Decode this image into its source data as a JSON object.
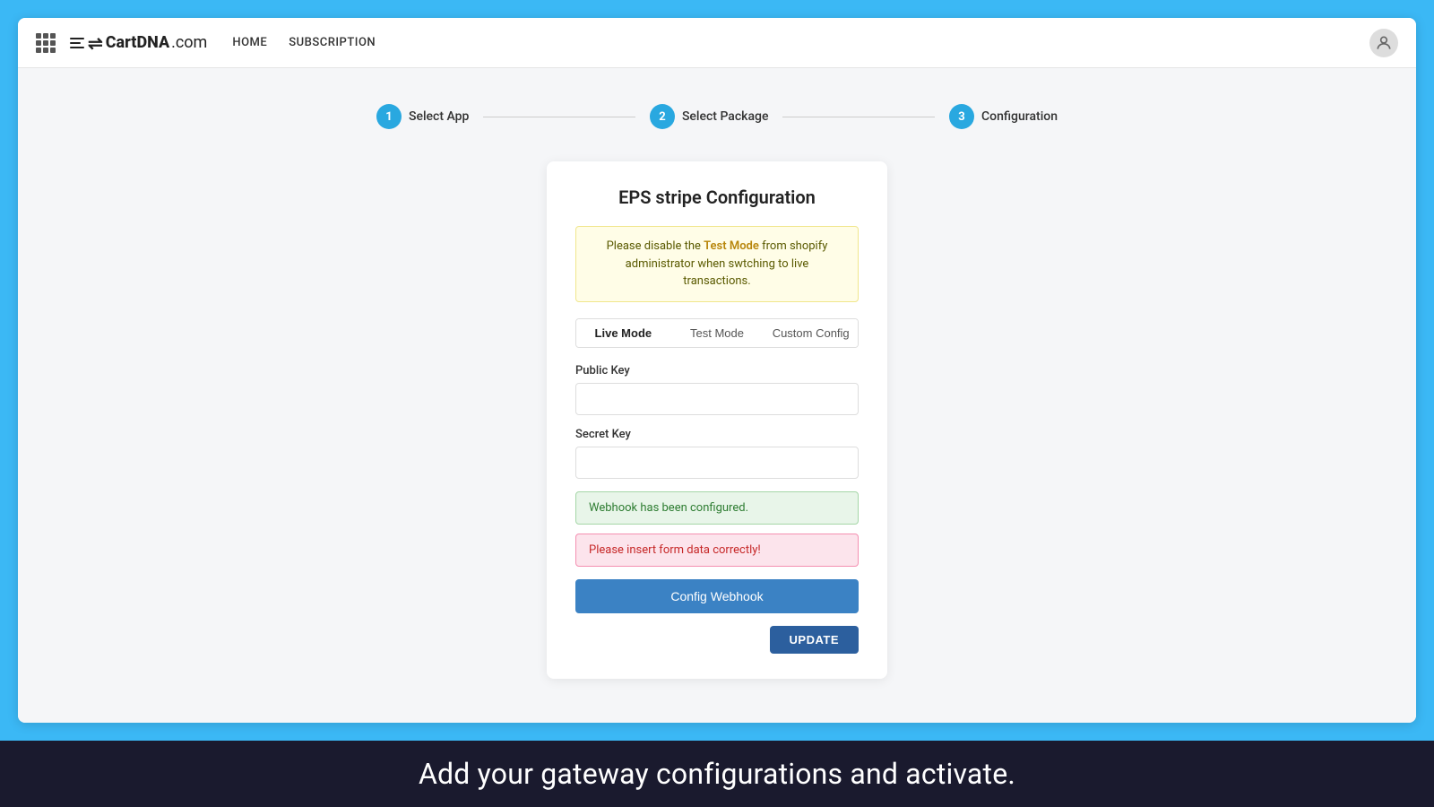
{
  "navbar": {
    "logo_text": "CartDNA",
    "logo_domain": ".com",
    "nav_links": [
      {
        "label": "HOME",
        "href": "#"
      },
      {
        "label": "SUBSCRIPTION",
        "href": "#"
      }
    ]
  },
  "stepper": {
    "steps": [
      {
        "number": "1",
        "label": "Select App"
      },
      {
        "number": "2",
        "label": "Select Package"
      },
      {
        "number": "3",
        "label": "Configuration"
      }
    ]
  },
  "card": {
    "title": "EPS stripe Configuration",
    "warning_text_1": "Please disable the ",
    "warning_highlight": "Test Mode",
    "warning_text_2": " from shopify",
    "warning_text_3": "administrator when swtching to live transactions.",
    "tabs": [
      {
        "label": "Live Mode",
        "active": true
      },
      {
        "label": "Test Mode",
        "active": false
      },
      {
        "label": "Custom Config",
        "active": false
      }
    ],
    "public_key_label": "Public Key",
    "public_key_placeholder": "",
    "secret_key_label": "Secret Key",
    "secret_key_placeholder": "",
    "success_message": "Webhook has been configured.",
    "error_message": "Please insert form data correctly!",
    "webhook_button_label": "Config Webhook",
    "update_button_label": "UPDATE"
  },
  "caption": {
    "text": "Add your gateway configurations and activate."
  }
}
